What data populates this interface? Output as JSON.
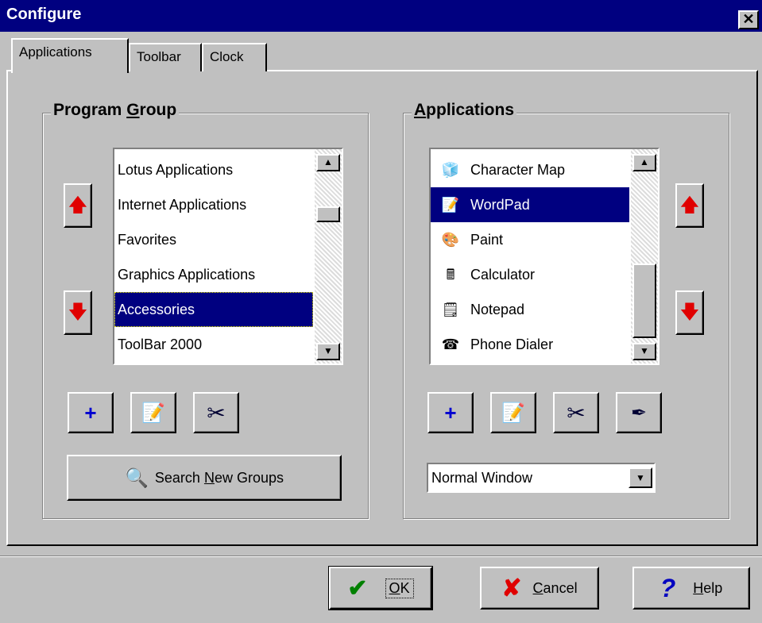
{
  "window": {
    "title": "Configure",
    "close_label": "✕"
  },
  "tabs": [
    {
      "label": "Applications",
      "active": true
    },
    {
      "label": "Toolbar",
      "active": false
    },
    {
      "label": "Clock",
      "active": false
    }
  ],
  "program_group": {
    "title": "Program Group",
    "items": [
      "Lotus Applications",
      "Internet Applications",
      "Favorites",
      "Graphics Applications",
      "Accessories",
      "ToolBar 2000"
    ],
    "selected": "Accessories",
    "search_button": "Search New Groups"
  },
  "applications": {
    "title": "Applications",
    "items": [
      {
        "label": "Character Map",
        "icon": "character-map-icon"
      },
      {
        "label": "WordPad",
        "icon": "wordpad-icon"
      },
      {
        "label": "Paint",
        "icon": "paint-icon"
      },
      {
        "label": "Calculator",
        "icon": "calculator-icon"
      },
      {
        "label": "Notepad",
        "icon": "notepad-icon"
      },
      {
        "label": "Phone Dialer",
        "icon": "phone-dialer-icon"
      }
    ],
    "selected": "WordPad",
    "window_mode": "Normal Window"
  },
  "footer": {
    "ok": "OK",
    "cancel": "Cancel",
    "help": "Help"
  },
  "colors": {
    "selection": "#000080",
    "face": "#c0c0c0",
    "arrow": "#e00000"
  }
}
